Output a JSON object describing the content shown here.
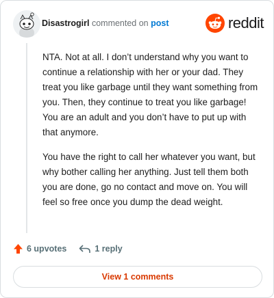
{
  "comment": {
    "username": "Disastrogirl",
    "action_text": "commented on",
    "post_link": "post",
    "paragraphs": [
      "NTA. Not at all. I don’t understand why you want to continue a relationship with her or your dad. They treat you like garbage until they want something from you. Then, they continue to treat you like garbage! You are an adult and you don’t have to put up with that anymore.",
      "You have the right to call her whatever you want, but why bother calling her anything. Just tell them both you are done, go no contact and move on. You will feel so free once you dump the dead weight."
    ],
    "upvotes_label": "6 upvotes",
    "reply_label": "1 reply",
    "view_comments_label": "View 1 comments"
  },
  "brand": {
    "wordmark": "reddit",
    "accent": "#ff4500"
  },
  "colors": {
    "upvote": "#ff4500",
    "link": "#0079d3",
    "view_button_text": "#d93900"
  },
  "icons": {
    "avatar": "snoo-avatar-icon",
    "logo": "reddit-logo-icon",
    "upvote": "upvote-arrow-icon",
    "reply": "reply-arrow-icon"
  }
}
